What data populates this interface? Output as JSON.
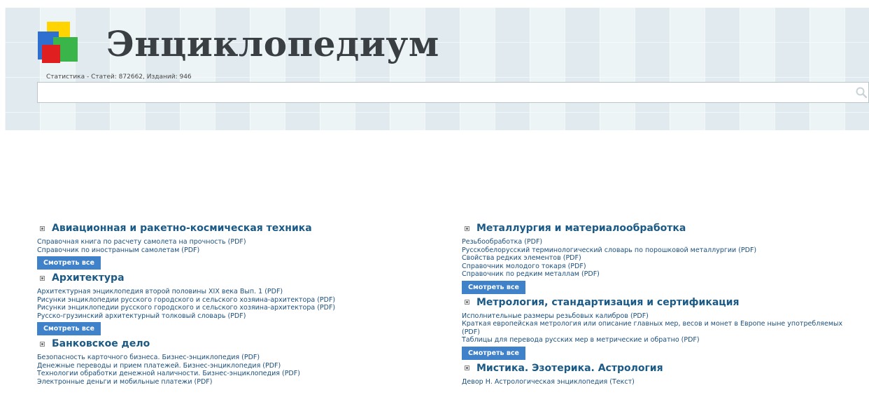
{
  "header": {
    "title": "Энциклопедиум",
    "stats": "Статистика - Статей: 872662, Изданий: 946",
    "search": {
      "placeholder": "",
      "value": ""
    }
  },
  "left_column": [
    {
      "title": "Авиационная и ракетно-космическая техника",
      "items": [
        "Справочная книга по расчету самолета на прочность (PDF)",
        "Справочник по иностранным самолетам (PDF)"
      ],
      "button": "Смотреть все"
    },
    {
      "title": "Архитектура",
      "items": [
        "Архитектурная энциклопедия второй половины XIX века Вып. 1 (PDF)",
        "Рисунки энциклопедии русского городского и сельского хозяина-архитектора (PDF)",
        "Рисунки энциклопедии русского городского и сельского хозяина-архитектора (PDF)",
        "Русско-грузинский архитектурный толковый словарь (PDF)"
      ],
      "button": "Смотреть все"
    },
    {
      "title": "Банковское дело",
      "items": [
        "Безопасность карточного бизнеса. Бизнес-энциклопедия (PDF)",
        "Денежные переводы и прием платежей. Бизнес-энциклопедия (PDF)",
        "Технологии обработки денежной наличности. Бизнес-энциклопедия (PDF)",
        "Электронные деньги и мобильные платежи (PDF)"
      ]
    }
  ],
  "right_column": [
    {
      "title": "Металлургия и материалообработка",
      "items": [
        "Резьбообработка (PDF)",
        "Русскобелорусский терминологический словарь по порошковой металлургии (PDF)",
        "Свойства редких элементов (PDF)",
        "Справочник молодого токаря (PDF)",
        "Справочник по редким металлам (PDF)"
      ],
      "button": "Смотреть все"
    },
    {
      "title": "Метрология, стандартизация и сертификация",
      "items": [
        "Исполнительные размеры резьбовых калибров (PDF)",
        "Краткая европейская метрология или описание главных мер, весов и монет в Европе ныне употребляемых (PDF)",
        "Таблицы для перевода русских мер в метрические и обратно (PDF)"
      ],
      "button": "Смотреть все"
    },
    {
      "title": "Мистика. Эзотерика. Астрология",
      "items": [
        "Девор Н. Астрологическая энциклопедия (Текст)"
      ]
    }
  ]
}
